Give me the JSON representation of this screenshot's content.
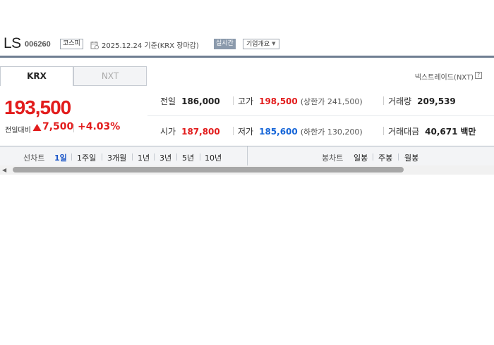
{
  "header": {
    "stock_name": "LS",
    "stock_code": "006260",
    "market": "코스피",
    "date_text": "2025.12.24 기준(KRX 장마감)",
    "realtime_label": "실시간",
    "overview_label": "기업개요"
  },
  "tabs": [
    {
      "label": "KRX",
      "active": true
    },
    {
      "label": "NXT",
      "active": false
    }
  ],
  "nxt_link": "넥스트레이드(NXT)",
  "price": {
    "current": "193,500",
    "change_label": "전일대비",
    "change_amount": "7,500",
    "change_rate": "+4.03%",
    "direction": "up",
    "up_color": "#e21c1c"
  },
  "stats": {
    "prev_close": {
      "label": "전일",
      "value": "186,000"
    },
    "high": {
      "label": "고가",
      "value": "198,500",
      "sub": "(상한가 241,500)"
    },
    "volume": {
      "label": "거래량",
      "value": "209,539"
    },
    "open": {
      "label": "시가",
      "value": "187,800"
    },
    "low": {
      "label": "저가",
      "value": "185,600",
      "sub": "(하한가 130,200)"
    },
    "amount": {
      "label": "거래대금",
      "value": "40,671",
      "unit": "백만"
    }
  },
  "chart_tabs": {
    "line_label": "선차트",
    "line_periods": [
      "1일",
      "1주일",
      "3개월",
      "1년",
      "3년",
      "5년",
      "10년"
    ],
    "active_period": "1일",
    "candle_label": "봉차트",
    "candle_periods": [
      "일봉",
      "주봉",
      "월봉"
    ]
  },
  "colors": {
    "up": "#e21c1c",
    "down": "#1565d8",
    "accent": "#6f7e92",
    "active_tab": "#1a55c7"
  }
}
